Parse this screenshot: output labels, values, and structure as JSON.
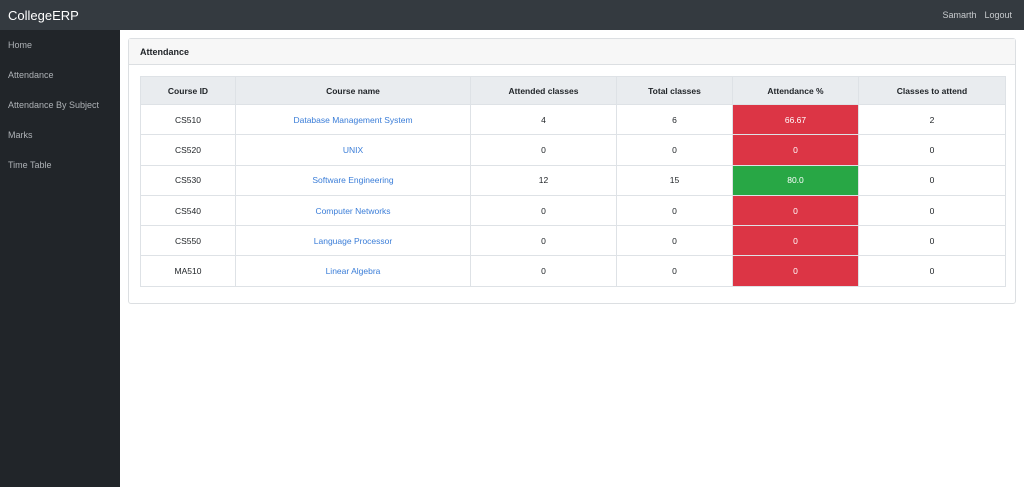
{
  "navbar": {
    "brand": "CollegeERP",
    "user": "Samarth",
    "logout": "Logout"
  },
  "sidebar": {
    "items": [
      {
        "label": "Home"
      },
      {
        "label": "Attendance"
      },
      {
        "label": "Attendance By Subject"
      },
      {
        "label": "Marks"
      },
      {
        "label": "Time Table"
      }
    ]
  },
  "card": {
    "title": "Attendance"
  },
  "table": {
    "headers": [
      "Course ID",
      "Course name",
      "Attended classes",
      "Total classes",
      "Attendance %",
      "Classes to attend"
    ],
    "rows": [
      {
        "course_id": "CS510",
        "course_name": "Database Management System",
        "attended": "4",
        "total": "6",
        "percent": "66.67",
        "status": "low",
        "to_attend": "2"
      },
      {
        "course_id": "CS520",
        "course_name": "UNIX",
        "attended": "0",
        "total": "0",
        "percent": "0",
        "status": "low",
        "to_attend": "0"
      },
      {
        "course_id": "CS530",
        "course_name": "Software Engineering",
        "attended": "12",
        "total": "15",
        "percent": "80.0",
        "status": "ok",
        "to_attend": "0"
      },
      {
        "course_id": "CS540",
        "course_name": "Computer Networks",
        "attended": "0",
        "total": "0",
        "percent": "0",
        "status": "low",
        "to_attend": "0"
      },
      {
        "course_id": "CS550",
        "course_name": "Language Processor",
        "attended": "0",
        "total": "0",
        "percent": "0",
        "status": "low",
        "to_attend": "0"
      },
      {
        "course_id": "MA510",
        "course_name": "Linear Algebra",
        "attended": "0",
        "total": "0",
        "percent": "0",
        "status": "low",
        "to_attend": "0"
      }
    ]
  },
  "colors": {
    "low": "#dc3545",
    "ok": "#28a745",
    "link": "#3a7dd8",
    "navbar": "#343a40",
    "sidebar": "#212529"
  }
}
